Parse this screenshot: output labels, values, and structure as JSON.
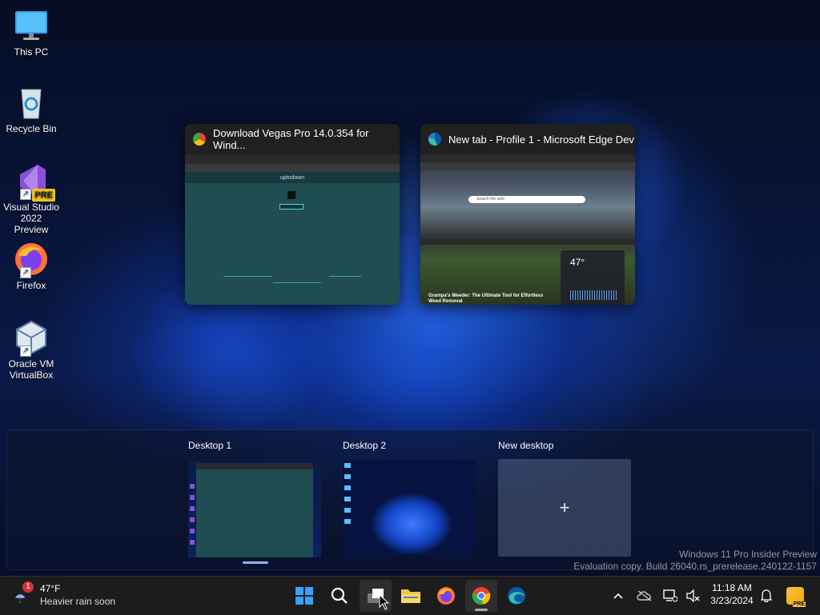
{
  "desktop": {
    "icons": [
      {
        "label": "This PC",
        "icon": "monitor-icon"
      },
      {
        "label": "Recycle Bin",
        "icon": "recycle-bin-icon"
      },
      {
        "label": "Visual Studio 2022 Preview",
        "icon": "visual-studio-icon",
        "badge": "PRE"
      },
      {
        "label": "Firefox",
        "icon": "firefox-icon"
      },
      {
        "label": "Oracle VM VirtualBox",
        "icon": "virtualbox-icon"
      }
    ]
  },
  "task_view": {
    "windows": [
      {
        "title": "Download Vegas Pro 14.0.354 for Wind...",
        "app": "chrome",
        "site_name": "uptodown"
      },
      {
        "title": "New tab - Profile 1 - Microsoft Edge Dev",
        "app": "edge",
        "search_placeholder": "Search the web",
        "weather_temp": "47°",
        "headline": "Grampa's Weeder: The Ultimate Tool for Effortless Weed Removal"
      }
    ],
    "desktops": [
      {
        "label": "Desktop 1"
      },
      {
        "label": "Desktop 2"
      },
      {
        "label": "New desktop",
        "plus": "+"
      }
    ]
  },
  "watermark": {
    "line1": "Windows 11 Pro Insider Preview",
    "line2": "Evaluation copy. Build 26040.rs_prerelease.240122-1157"
  },
  "taskbar": {
    "weather": {
      "temp": "47°F",
      "desc": "Heavier rain soon",
      "badge": "1"
    },
    "apps": [
      "start-icon",
      "search-icon",
      "task-view-icon",
      "file-explorer-icon",
      "firefox-icon",
      "chrome-icon",
      "edge-icon"
    ],
    "tray": {
      "time": "11:18 AM",
      "date": "3/23/2024",
      "chevron": "^"
    }
  },
  "colors": {
    "accent": "#0078d4",
    "taskbar": "#1c1c1c",
    "thumb_teal": "#1f4d52"
  }
}
